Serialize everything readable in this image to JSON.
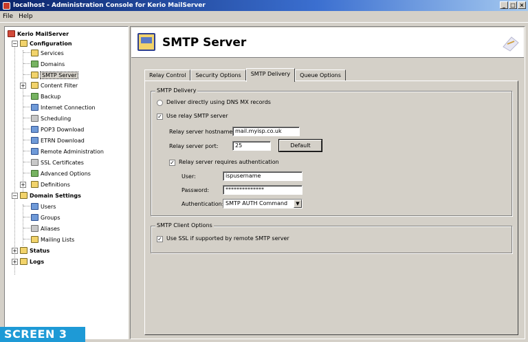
{
  "window": {
    "title": "localhost - Administration Console for Kerio MailServer",
    "buttons": [
      "_",
      "□",
      "×"
    ]
  },
  "menu": [
    "File",
    "Help"
  ],
  "tree": {
    "items": [
      {
        "label": "Kerio MailServer",
        "icon": "red",
        "bold": true
      },
      {
        "label": "Configuration",
        "icon": "yellow",
        "bold": true
      },
      {
        "label": "Services",
        "icon": "yellow"
      },
      {
        "label": "Domains",
        "icon": "green"
      },
      {
        "label": "SMTP Server",
        "icon": "yellow",
        "selected": true
      },
      {
        "label": "Content Filter",
        "icon": "yellow"
      },
      {
        "label": "Backup",
        "icon": "green"
      },
      {
        "label": "Internet Connection",
        "icon": "blue"
      },
      {
        "label": "Scheduling",
        "icon": "gray"
      },
      {
        "label": "POP3 Download",
        "icon": "blue"
      },
      {
        "label": "ETRN Download",
        "icon": "blue"
      },
      {
        "label": "Remote Administration",
        "icon": "blue"
      },
      {
        "label": "SSL Certificates",
        "icon": "gray"
      },
      {
        "label": "Advanced Options",
        "icon": "green"
      },
      {
        "label": "Definitions",
        "icon": "yellow"
      },
      {
        "label": "Domain Settings",
        "icon": "yellow",
        "bold": true
      },
      {
        "label": "Users",
        "icon": "blue"
      },
      {
        "label": "Groups",
        "icon": "blue"
      },
      {
        "label": "Aliases",
        "icon": "gray"
      },
      {
        "label": "Mailing Lists",
        "icon": "yellow"
      },
      {
        "label": "Status",
        "icon": "yellow",
        "bold": true
      },
      {
        "label": "Logs",
        "icon": "yellow",
        "bold": true
      }
    ]
  },
  "badge": "SCREEN 3",
  "header": {
    "title": "SMTP Server"
  },
  "tabs": [
    "Relay Control",
    "Security Options",
    "SMTP Delivery",
    "Queue Options"
  ],
  "active_tab": "SMTP Delivery",
  "smtp_delivery": {
    "legend": "SMTP Delivery",
    "option_direct": "Deliver directly using DNS MX records",
    "option_relay": "Use relay SMTP server",
    "hostname_label": "Relay server hostname:",
    "hostname_value": "mail.myisp.co.uk",
    "port_label": "Relay server port:",
    "port_value": "25",
    "default_button": "Default",
    "auth_required_label": "Relay server requires authentication",
    "user_label": "User:",
    "user_value": "ispusername",
    "password_label": "Password:",
    "password_value": "**************",
    "auth_label": "Authentication:",
    "auth_value": "SMTP AUTH Command"
  },
  "client_options": {
    "legend": "SMTP Client Options",
    "use_ssl": "Use SSL if supported by remote SMTP server"
  }
}
